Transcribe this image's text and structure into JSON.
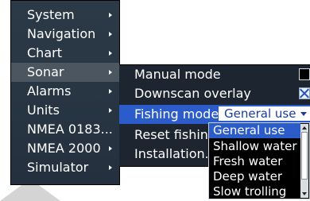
{
  "main_menu": {
    "items": [
      {
        "label": "System",
        "selected": false
      },
      {
        "label": "Navigation",
        "selected": false
      },
      {
        "label": "Chart",
        "selected": false
      },
      {
        "label": "Sonar",
        "selected": true
      },
      {
        "label": "Alarms",
        "selected": false
      },
      {
        "label": "Units",
        "selected": false
      },
      {
        "label": "NMEA 0183...",
        "selected": false
      },
      {
        "label": "NMEA 2000",
        "selected": false
      },
      {
        "label": "Simulator",
        "selected": false
      }
    ]
  },
  "sonar_menu": {
    "manual_mode_label": "Manual mode",
    "manual_mode_checked": false,
    "downscan_overlay_label": "Downscan overlay",
    "downscan_overlay_checked": true,
    "fishing_mode_label": "Fishing mode",
    "fishing_mode_value": "General use",
    "reset_fishing_label": "Reset fishing",
    "installation_label": "Installation..."
  },
  "fishing_mode_dropdown": {
    "selected": "General use",
    "options": [
      "General use",
      "Shallow water",
      "Fresh water",
      "Deep water",
      "Slow trolling"
    ]
  },
  "colors": {
    "highlight": "#2b5cc9",
    "menu_background": "#2c3a48",
    "selected_row": "#4b5660"
  }
}
